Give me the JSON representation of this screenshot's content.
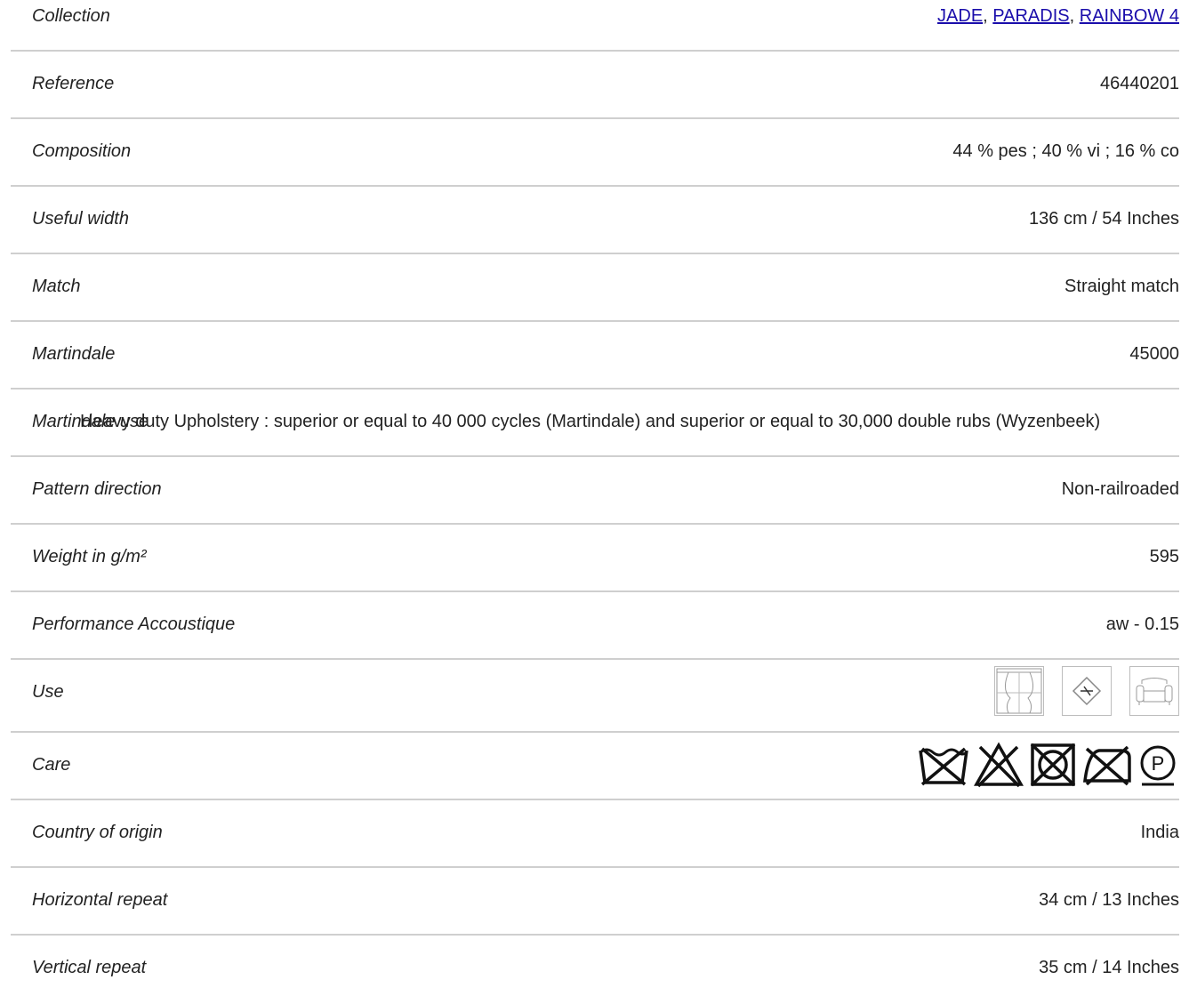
{
  "rows": {
    "collection": {
      "label": "Collection",
      "links": [
        "JADE",
        "PARADIS",
        "RAINBOW 4"
      ],
      "sep": ", "
    },
    "reference": {
      "label": "Reference",
      "value": "46440201"
    },
    "composition": {
      "label": "Composition",
      "value": "44 % pes ; 40 % vi ; 16 % co"
    },
    "useful_width": {
      "label": "Useful width",
      "value": "136 cm / 54 Inches"
    },
    "match": {
      "label": "Match",
      "value": "Straight match"
    },
    "martindale": {
      "label": "Martindale",
      "value": "45000"
    },
    "martindale_use": {
      "label": "Martindale use",
      "value": "Heavy duty Upholstery : superior or equal to 40 000 cycles (Martindale) and superior or equal to 30,000 double rubs (Wyzenbeek)"
    },
    "pattern_direction": {
      "label": "Pattern direction",
      "value": "Non-railroaded"
    },
    "weight": {
      "label": "Weight in g/m²",
      "value": "595"
    },
    "acoustic": {
      "label": "Performance Accoustique",
      "value": "aw - 0.15"
    },
    "use": {
      "label": "Use",
      "icons": [
        "curtain-icon",
        "no-wall-covering-icon",
        "armchair-icon"
      ]
    },
    "care": {
      "label": "Care",
      "icons": [
        "do-not-wash-icon",
        "do-not-bleach-icon",
        "do-not-tumble-dry-icon",
        "do-not-iron-icon",
        "dry-clean-p-icon"
      ],
      "dry_clean_letter": "P"
    },
    "country": {
      "label": "Country of origin",
      "value": "India"
    },
    "horizontal_repeat": {
      "label": "Horizontal repeat",
      "value": "34 cm / 13 Inches"
    },
    "vertical_repeat": {
      "label": "Vertical repeat",
      "value": "35 cm / 14 Inches"
    }
  }
}
